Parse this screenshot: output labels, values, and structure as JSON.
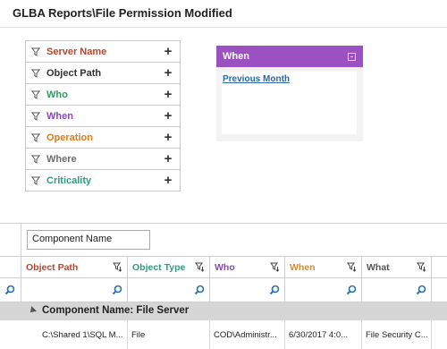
{
  "page": {
    "title": "GLBA Reports\\File Permission Modified"
  },
  "filters": [
    {
      "label": "Server Name",
      "color": "#b5462c"
    },
    {
      "label": "Object Path",
      "color": "#333333"
    },
    {
      "label": "Who",
      "color": "#2e9a63"
    },
    {
      "label": "When",
      "color": "#8a46b5"
    },
    {
      "label": "Operation",
      "color": "#e07b1a"
    },
    {
      "label": "Where",
      "color": "#6d6d6d"
    },
    {
      "label": "Criticality",
      "color": "#2d9c86"
    }
  ],
  "filter_add_symbol": "+",
  "when_panel": {
    "title": "When",
    "header_color": "#9b52c0",
    "link": "Previous Month"
  },
  "grouping": {
    "chip_label": "Component Name"
  },
  "grid": {
    "columns": [
      {
        "label": "Object Path",
        "color": "#b5462c"
      },
      {
        "label": "Object Type",
        "color": "#2d9c86"
      },
      {
        "label": "Who",
        "color": "#8a46b5"
      },
      {
        "label": "When",
        "color": "#e08a1a"
      },
      {
        "label": "What",
        "color": "#555555"
      }
    ],
    "group_row": {
      "label": "Component Name: File Server"
    },
    "rows": [
      {
        "cells": [
          "C:\\Shared 1\\SQL M...",
          "File",
          "COD\\Administr...",
          "6/30/2017 4:0...",
          "File Security C..."
        ]
      }
    ]
  },
  "icons": {
    "filter": "funnel-icon",
    "search": "magnifier-icon",
    "collapse": "collapse-square-icon",
    "expand": "expand-triangle-icon"
  },
  "colors": {
    "link": "#2a68a8",
    "search_icon": "#2a6fb3",
    "group_bg": "#d6d6d6"
  }
}
